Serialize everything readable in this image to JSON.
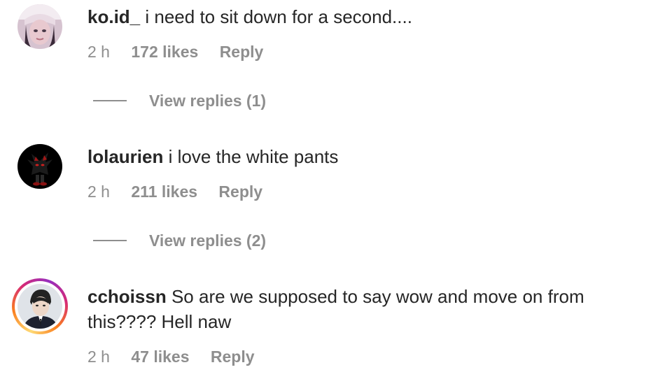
{
  "comments": [
    {
      "username": "ko.id_",
      "text": "i need to sit down for a second....",
      "time": "2 h",
      "likes": "172 likes",
      "reply": "Reply",
      "view_replies": "View replies (1)",
      "avatar_style": "plain",
      "avatar_colors": [
        "#3b2b3a",
        "#c9b4c8",
        "#f1e4ee"
      ]
    },
    {
      "username": "lolaurien",
      "text": "i love the white pants",
      "time": "2 h",
      "likes": "211 likes",
      "reply": "Reply",
      "view_replies": "View replies (2)",
      "avatar_style": "plain",
      "avatar_colors": [
        "#000000",
        "#1a1a1a",
        "#b01c1c"
      ]
    },
    {
      "username": "cchoissn",
      "text": "So are we supposed to say wow and move on from this???? Hell naw",
      "time": "2 h",
      "likes": "47 likes",
      "reply": "Reply",
      "avatar_style": "story-ring",
      "avatar_colors": [
        "#d9dde2",
        "#2b2b2b",
        "#1f2430"
      ]
    }
  ],
  "colors": {
    "text": "#262626",
    "secondary": "#8e8e8e",
    "background": "#ffffff"
  }
}
